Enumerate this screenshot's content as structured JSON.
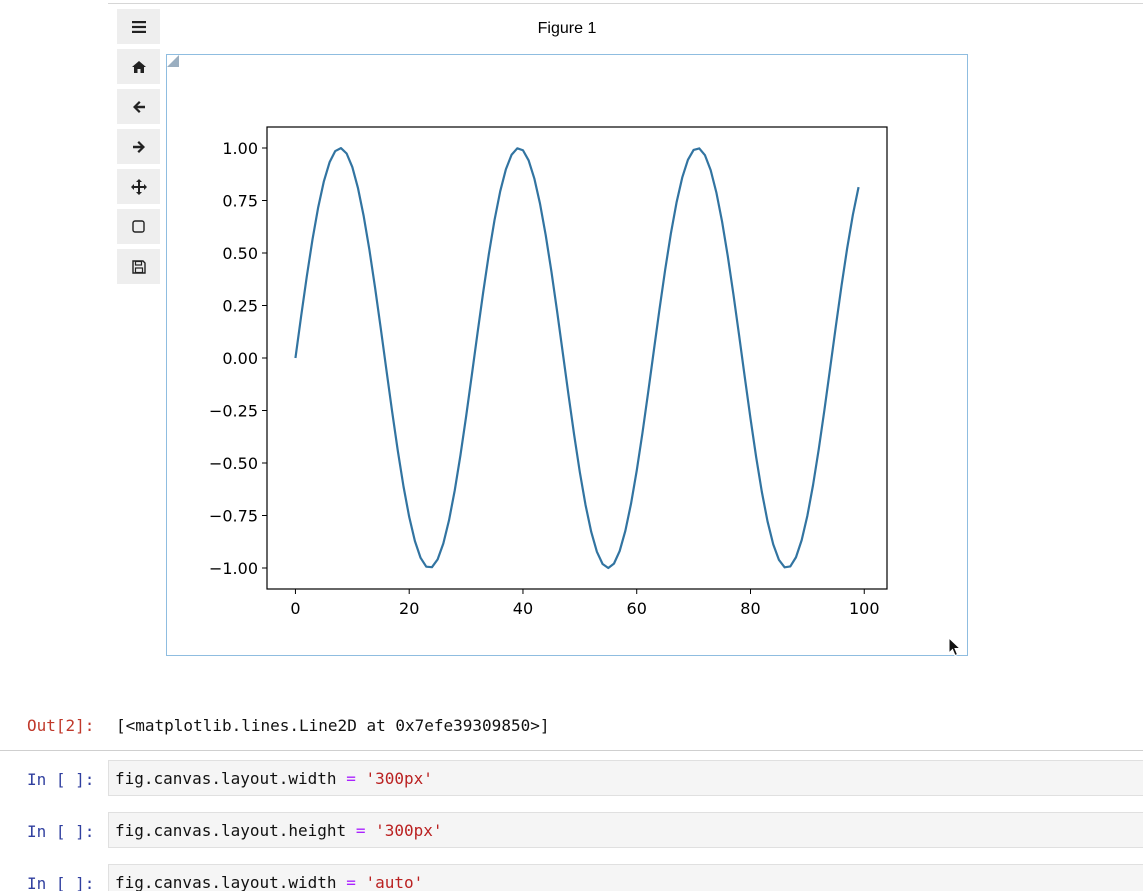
{
  "figure": {
    "title": "Figure 1"
  },
  "toolbar": {
    "buttons": [
      {
        "name": "menu",
        "icon": "hamburger-icon"
      },
      {
        "name": "home",
        "icon": "home-icon"
      },
      {
        "name": "back",
        "icon": "arrow-left-icon"
      },
      {
        "name": "forward",
        "icon": "arrow-right-icon"
      },
      {
        "name": "pan",
        "icon": "move-icon"
      },
      {
        "name": "zoom",
        "icon": "square-icon"
      },
      {
        "name": "save",
        "icon": "floppy-icon"
      }
    ]
  },
  "chart_data": {
    "type": "line",
    "title": "",
    "xlabel": "",
    "ylabel": "",
    "xlim": [
      -5,
      104
    ],
    "ylim": [
      -1.1,
      1.1
    ],
    "xticks": [
      "0",
      "20",
      "40",
      "60",
      "80",
      "100"
    ],
    "yticks": [
      "1.00",
      "0.75",
      "0.50",
      "0.25",
      "0.00",
      "−0.25",
      "−0.50",
      "−0.75",
      "−1.00"
    ],
    "series": [
      {
        "function": "sin(x/5)",
        "x_start": 0,
        "x_end": 99,
        "x_step": 1,
        "color": "#3274a1"
      }
    ],
    "grid": false
  },
  "output": {
    "prompt": "Out[2]:",
    "text": "[<matplotlib.lines.Line2D at 0x7efe39309850>]"
  },
  "cells": [
    {
      "prompt": "In [ ]:",
      "lhs": "fig.canvas.layout.width",
      "op": "=",
      "rhs": "'300px'"
    },
    {
      "prompt": "In [ ]:",
      "lhs": "fig.canvas.layout.height",
      "op": "=",
      "rhs": "'300px'"
    },
    {
      "prompt": "In [ ]:",
      "lhs": "fig.canvas.layout.width",
      "op": "=",
      "rhs": "'auto'"
    }
  ],
  "colors": {
    "line": "#3274a1",
    "out_prompt": "#c0392b",
    "in_prompt": "#303f9f",
    "string": "#ba2121",
    "operator": "#aa22ff"
  }
}
